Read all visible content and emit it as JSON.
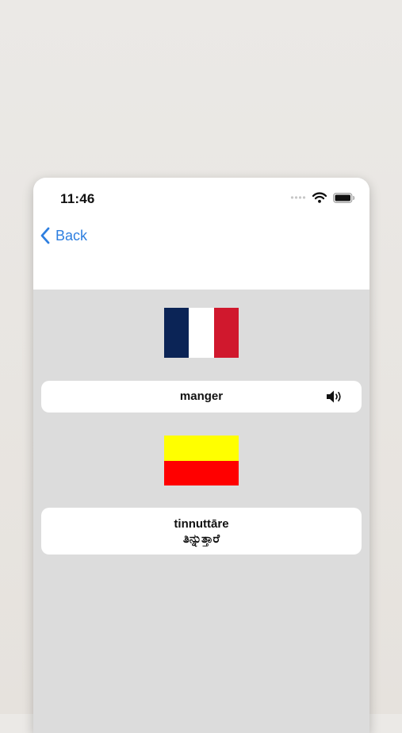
{
  "status_bar": {
    "time": "11:46",
    "icons": [
      "cellular-signal-icon",
      "wifi-icon",
      "battery-icon"
    ]
  },
  "nav": {
    "back_label": "Back",
    "back_icon": "chevron-left-icon"
  },
  "source": {
    "flag": "france-flag",
    "flag_colors": [
      "#0b2456",
      "#ffffff",
      "#d0182d"
    ],
    "word": "manger",
    "audio_icon": "speaker-icon"
  },
  "target": {
    "flag": "karnataka-flag",
    "flag_colors": [
      "#ffff00",
      "#ff0000"
    ],
    "romanization": "tinnuttāre",
    "native_script": "ತಿನ್ನುತ್ತಾರೆ"
  },
  "colors": {
    "accent": "#2e7fe0",
    "content_background": "#dcdcdc",
    "card_background": "#ffffff"
  }
}
